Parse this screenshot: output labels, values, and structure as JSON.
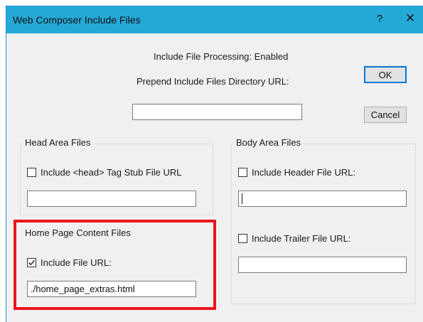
{
  "window": {
    "title": "Web Composer Include Files",
    "help_glyph": "?",
    "close_glyph": "✕"
  },
  "status": {
    "processing": "Include File Processing: Enabled",
    "prepend_label": "Prepend Include Files Directory URL:",
    "prepend_value": ""
  },
  "buttons": {
    "ok": "OK",
    "cancel": "Cancel"
  },
  "head_area": {
    "group_label": "Head Area Files",
    "checkbox_label": "Include <head> Tag Stub File URL",
    "checked": false,
    "value": ""
  },
  "home_page": {
    "group_label": "Home Page Content Files",
    "checkbox_label": "Include File URL:",
    "checked": true,
    "value": "./home_page_extras.html"
  },
  "body_area": {
    "group_label": "Body Area Files",
    "header_label": "Include Header File URL:",
    "header_checked": false,
    "header_value": "",
    "trailer_label": "Include Trailer File URL:",
    "trailer_checked": false,
    "trailer_value": ""
  },
  "colors": {
    "titlebar": "#24a9d6",
    "dialog_background": "#f0f0f0",
    "default_button_border": "#0078d7",
    "highlight": "#e8161b"
  },
  "icons": {
    "help": "help-icon",
    "close": "close-icon",
    "checkmark": "checkmark-icon"
  }
}
